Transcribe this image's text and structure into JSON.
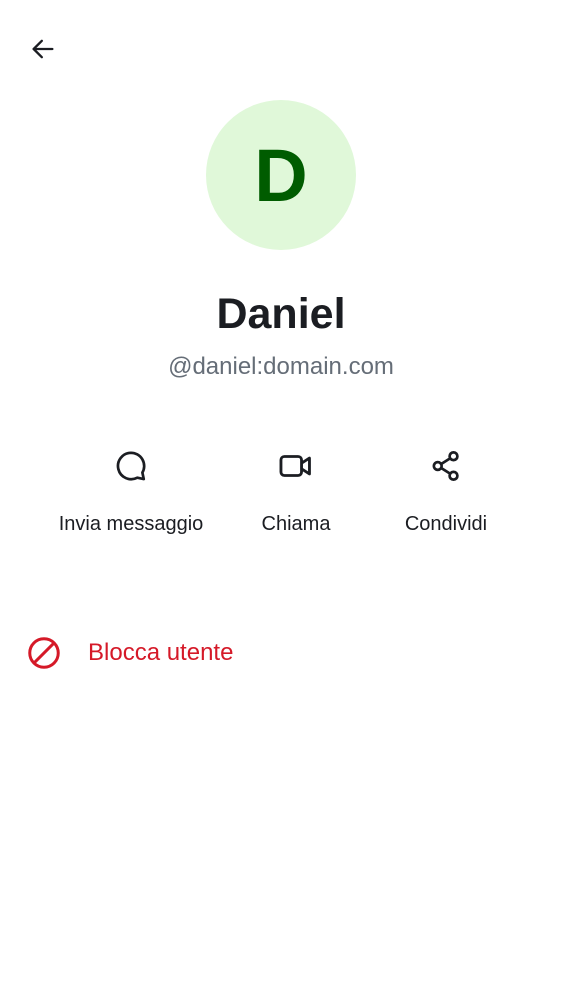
{
  "header": {
    "back_icon": "arrow-left-icon"
  },
  "profile": {
    "avatar_initial": "D",
    "avatar_background": "#e0f8d9",
    "avatar_foreground": "#005c00",
    "display_name": "Daniel",
    "user_id": "@daniel:domain.com"
  },
  "actions": [
    {
      "label": "Invia messaggio",
      "icon": "chat-bubble-icon"
    },
    {
      "label": "Chiama",
      "icon": "video-camera-icon"
    },
    {
      "label": "Condividi",
      "icon": "share-icon"
    }
  ],
  "block": {
    "label": "Blocca utente",
    "icon": "block-icon",
    "color": "#d51928"
  }
}
